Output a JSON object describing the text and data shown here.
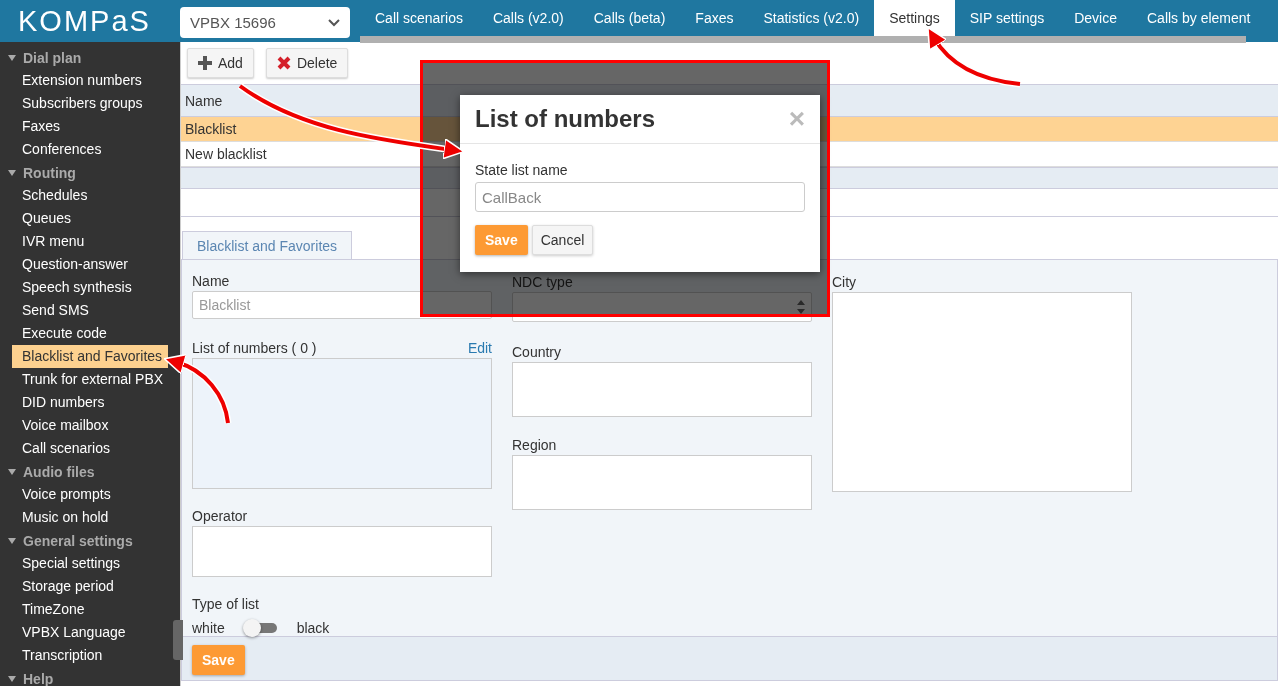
{
  "header": {
    "logo": "KOMPaS",
    "pbx_select": {
      "value": "VPBX 15696"
    },
    "tabs": [
      {
        "label": "Call scenarios",
        "selected": false
      },
      {
        "label": "Calls (v2.0)",
        "selected": false
      },
      {
        "label": "Calls (beta)",
        "selected": false
      },
      {
        "label": "Faxes",
        "selected": false
      },
      {
        "label": "Statistics (v2.0)",
        "selected": false
      },
      {
        "label": "Settings",
        "selected": true
      },
      {
        "label": "SIP settings",
        "selected": false
      },
      {
        "label": "Device",
        "selected": false
      },
      {
        "label": "Calls by element",
        "selected": false
      }
    ]
  },
  "sidebar": {
    "groups": [
      {
        "label": "Dial plan",
        "expanded": true,
        "children": [
          {
            "label": "Extension numbers",
            "selected": false
          },
          {
            "label": "Subscribers groups",
            "selected": false
          },
          {
            "label": "Faxes",
            "selected": false
          },
          {
            "label": "Conferences",
            "selected": false
          }
        ]
      },
      {
        "label": "Routing",
        "expanded": true,
        "children": [
          {
            "label": "Schedules",
            "selected": false
          },
          {
            "label": "Queues",
            "selected": false
          },
          {
            "label": "IVR menu",
            "selected": false
          },
          {
            "label": "Question-answer",
            "selected": false
          },
          {
            "label": "Speech synthesis",
            "selected": false
          },
          {
            "label": "Send SMS",
            "selected": false
          },
          {
            "label": "Execute code",
            "selected": false
          },
          {
            "label": "Blacklist and Favorites",
            "selected": true
          },
          {
            "label": "Trunk for external PBX",
            "selected": false
          },
          {
            "label": "DID numbers",
            "selected": false
          },
          {
            "label": "Voice mailbox",
            "selected": false
          },
          {
            "label": "Call scenarios",
            "selected": false
          }
        ]
      },
      {
        "label": "Audio files",
        "expanded": true,
        "children": [
          {
            "label": "Voice prompts",
            "selected": false
          },
          {
            "label": "Music on hold",
            "selected": false
          }
        ]
      },
      {
        "label": "General settings",
        "expanded": true,
        "children": [
          {
            "label": "Special settings",
            "selected": false
          },
          {
            "label": "Storage period",
            "selected": false
          },
          {
            "label": "TimeZone",
            "selected": false
          },
          {
            "label": "VPBX Language",
            "selected": false
          },
          {
            "label": "Transcription",
            "selected": false
          }
        ]
      },
      {
        "label": "Help",
        "expanded": true
      }
    ]
  },
  "toolbar": [
    {
      "kind": "add",
      "label": "Add"
    },
    {
      "kind": "delete",
      "label": "Delete"
    }
  ],
  "table": {
    "columns": [
      "Name"
    ],
    "rows": [
      {
        "cells": [
          "Blacklist"
        ],
        "selected": true
      },
      {
        "cells": [
          "New blacklist"
        ],
        "selected": false
      }
    ]
  },
  "detail_tabs": [
    {
      "label": "Blacklist and Favorites",
      "selected": true
    }
  ],
  "form": {
    "columns": [
      [
        {
          "kind": "input",
          "label": "Name",
          "value": "Blacklist"
        },
        {
          "kind": "list",
          "label": "List of numbers ( 0 )",
          "link": "Edit"
        },
        {
          "kind": "textarea",
          "label": "Operator"
        },
        {
          "kind": "toggle",
          "label": "Type of list",
          "off_label": "white",
          "on_label": "black",
          "on": false
        }
      ],
      [
        {
          "kind": "spinner",
          "label": "NDC type"
        },
        {
          "kind": "textarea",
          "label": "Country"
        },
        {
          "kind": "textarea",
          "label": "Region"
        }
      ],
      [
        {
          "kind": "tall_box",
          "label": "City"
        }
      ]
    ],
    "save": "Save"
  },
  "dialog": {
    "title": "List of numbers",
    "close": "×",
    "field_label": "State list name",
    "value": "CallBack",
    "buttons": [
      {
        "kind": "primary",
        "label": "Save"
      },
      {
        "kind": "secondary",
        "label": "Cancel"
      }
    ]
  }
}
